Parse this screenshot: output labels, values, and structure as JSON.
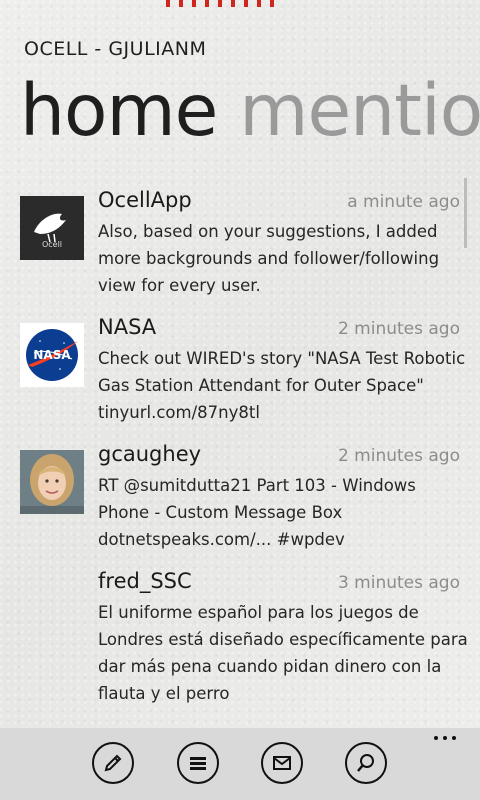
{
  "app": {
    "title": "OCELL - GJULIANM"
  },
  "pivot": {
    "active": "home",
    "next": "mention"
  },
  "tweets": [
    {
      "user": "OcellApp",
      "time": "a minute ago",
      "text": "Also, based on your suggestions, I added more backgrounds and follower/following view for every user.",
      "avatar": "ocell-bird-icon",
      "avatar_caption": "Ocell"
    },
    {
      "user": "NASA",
      "time": "2 minutes ago",
      "text": "Check out WIRED's story \"NASA Test Robotic Gas Station Attendant for Outer Space\" tinyurl.com/87ny8tl",
      "avatar": "nasa-logo-icon",
      "avatar_caption": "NASA"
    },
    {
      "user": "gcaughey",
      "time": "2 minutes ago",
      "text": "RT @sumitdutta21 Part 103 - Windows Phone - Custom Message Box dotnetspeaks.com/... #wpdev",
      "avatar": "profile-photo"
    },
    {
      "user": "fred_SSC",
      "time": "3 minutes ago",
      "text": "El uniforme español para los juegos de Londres está diseñado específicamente para dar más pena cuando pidan dinero con la flauta y el perro"
    }
  ],
  "appbar": {
    "buttons": [
      "compose-icon",
      "lists-icon",
      "messages-icon",
      "search-icon"
    ],
    "more": "more-options-icon"
  },
  "colors": {
    "accent": "#d0261d",
    "background": "#ebebea",
    "appbar": "#d9d9d9",
    "secondary_text": "#8c8c8c",
    "inactive_pivot": "#9a9a9a"
  }
}
